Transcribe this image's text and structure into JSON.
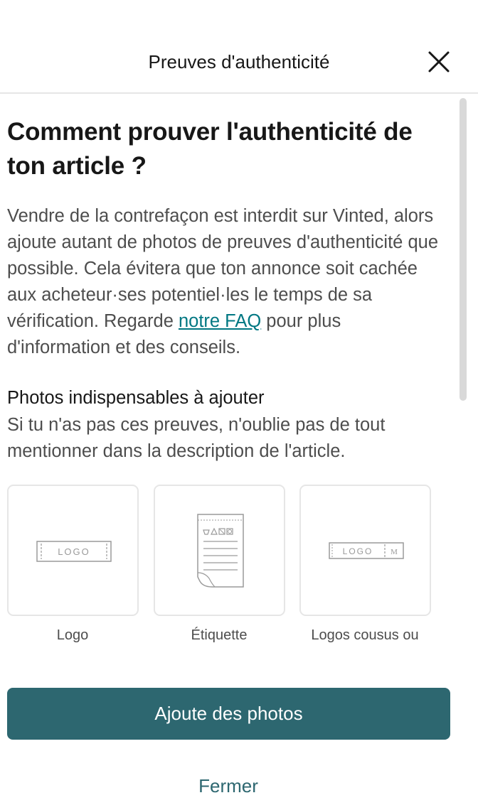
{
  "header": {
    "title": "Preuves d'authenticité",
    "close_icon": "close-icon"
  },
  "content": {
    "title": "Comment prouver l'authenticité de ton article ?",
    "intro_text": "Vendre de la contrefaçon est interdit sur Vinted, alors ajoute autant de photos de preuves d'authenticité que possible. Cela évitera que ton annonce soit cachée aux acheteur·ses potentiel·les le temps de sa vérification. Regarde ",
    "faq_link": "notre FAQ",
    "intro_text_end": " pour plus d'information et des conseils.",
    "section_title": "Photos indispensables à ajouter",
    "section_subtitle": "Si tu n'as pas ces preuves, n'oublie pas de tout mentionner dans la description de l'article.",
    "cards": [
      {
        "label": "Logo",
        "icon": "logo-label-icon",
        "icon_text": "LOGO"
      },
      {
        "label": "Étiquette",
        "icon": "care-tag-icon"
      },
      {
        "label": "Logos cousus ou",
        "icon": "sewn-logo-icon",
        "icon_text": "LOGO",
        "icon_text_2": "M"
      }
    ]
  },
  "footer": {
    "primary_label": "Ajoute des photos",
    "secondary_label": "Fermer"
  },
  "colors": {
    "accent": "#2d6770",
    "link": "#007782",
    "text_primary": "#171717",
    "text_secondary": "#4d4d4d",
    "border": "#e6e6e6"
  }
}
